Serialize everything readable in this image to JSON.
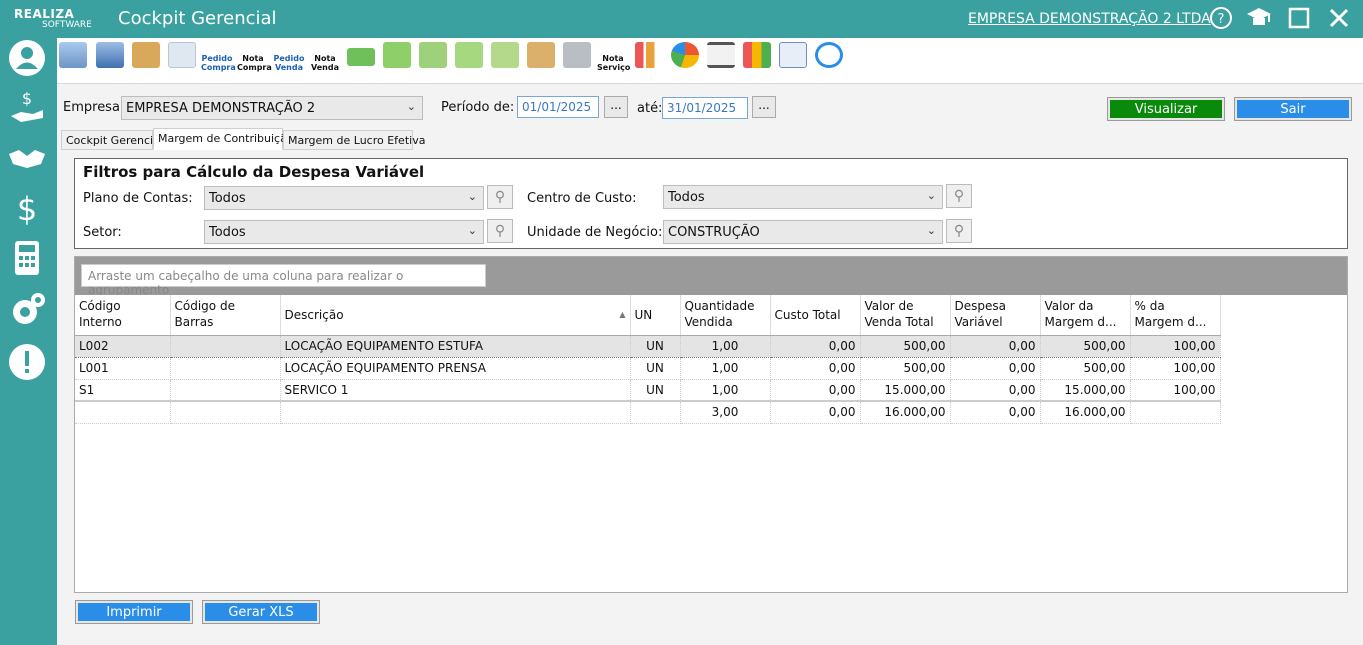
{
  "titlebar": {
    "logo_line1": "REALIZA",
    "logo_line2": "SOFTWARE",
    "title": "Cockpit Gerencial",
    "company": "EMPRESA DEMONSTRAÇÃO 2 LTDA"
  },
  "toolbar": {
    "pedido_compra": [
      "Pedido",
      "Compra"
    ],
    "nota_compra": [
      "Nota",
      "Compra"
    ],
    "pedido_venda": [
      "Pedido",
      "Venda"
    ],
    "nota_venda": [
      "Nota",
      "Venda"
    ],
    "nota_servico": [
      "Nota",
      "Serviço"
    ]
  },
  "header": {
    "empresa_label": "Empresa:",
    "empresa_value": "EMPRESA DEMONSTRAÇÃO 2",
    "periodo_label": "Período de:",
    "date_from": "01/01/2025",
    "ate_label": "até:",
    "date_to": "31/01/2025",
    "ellipsis": "...",
    "visualizar": "Visualizar",
    "sair": "Sair"
  },
  "tabs": [
    "Cockpit Gerencial",
    "Margem de Contribuição",
    "Margem de Lucro Efetiva"
  ],
  "filters": {
    "title": "Filtros para Cálculo da Despesa Variável",
    "plano_label": "Plano de Contas:",
    "plano_value": "Todos",
    "setor_label": "Setor:",
    "setor_value": "Todos",
    "centro_label": "Centro de Custo:",
    "centro_value": "Todos",
    "unidade_label": "Unidade de Negócio:",
    "unidade_value": "CONSTRUÇÃO"
  },
  "grid": {
    "group_hint": "Arraste um cabeçalho de uma coluna para realizar o agrupamento",
    "columns": [
      [
        "Código",
        "Interno"
      ],
      [
        "Código de",
        "Barras"
      ],
      [
        "Descrição"
      ],
      [
        "UN"
      ],
      [
        "Quantidade",
        "Vendida"
      ],
      [
        "Custo Total"
      ],
      [
        "Valor de",
        "Venda Total"
      ],
      [
        "Despesa",
        "Variável"
      ],
      [
        "Valor da",
        "Margem d..."
      ],
      [
        "% da",
        "Margem d..."
      ]
    ],
    "rows": [
      [
        "L002",
        "",
        "LOCAÇÃO EQUIPAMENTO ESTUFA",
        "UN",
        "1,00",
        "0,00",
        "500,00",
        "0,00",
        "500,00",
        "100,00"
      ],
      [
        "L001",
        "",
        "LOCAÇÃO EQUIPAMENTO PRENSA",
        "UN",
        "1,00",
        "0,00",
        "500,00",
        "0,00",
        "500,00",
        "100,00"
      ],
      [
        "S1",
        "",
        "SERVICO 1",
        "UN",
        "1,00",
        "0,00",
        "15.000,00",
        "0,00",
        "15.000,00",
        "100,00"
      ]
    ],
    "totals": [
      "",
      "",
      "",
      "",
      "3,00",
      "0,00",
      "16.000,00",
      "0,00",
      "16.000,00",
      ""
    ]
  },
  "footer": {
    "imprimir": "Imprimir",
    "gerar_xls": "Gerar XLS"
  }
}
